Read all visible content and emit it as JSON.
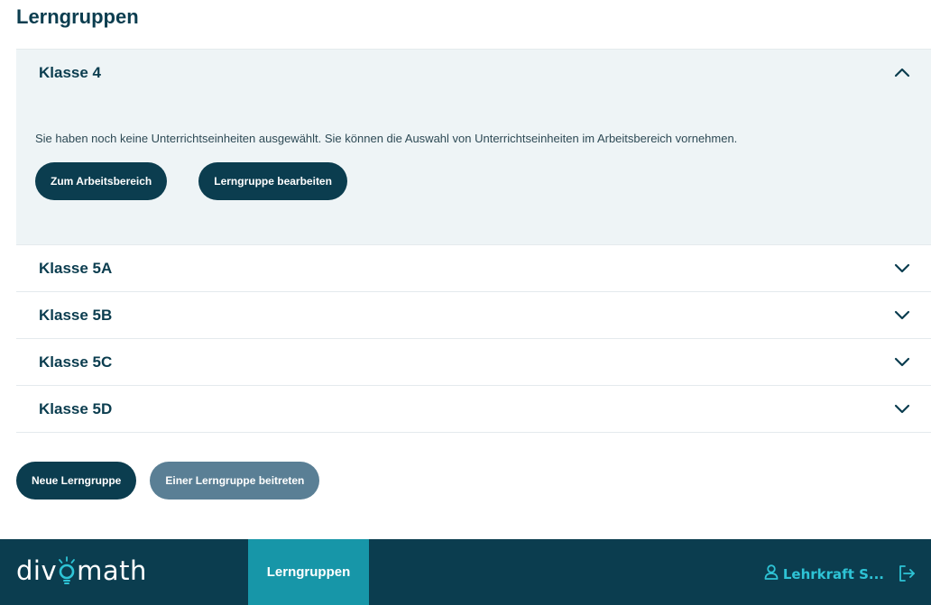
{
  "page": {
    "title": "Lerngruppen"
  },
  "groups": [
    {
      "name": "Klasse 4",
      "expanded": true,
      "message": "Sie haben noch keine Unterrichtseinheiten ausgewählt. Sie können die Auswahl von Unterrichtseinheiten im Arbeitsbereich vornehmen.",
      "buttons": [
        "Zum Arbeitsbereich",
        "Lerngruppe bearbeiten"
      ]
    },
    {
      "name": "Klasse 5A",
      "expanded": false
    },
    {
      "name": "Klasse 5B",
      "expanded": false
    },
    {
      "name": "Klasse 5C",
      "expanded": false
    },
    {
      "name": "Klasse 5D",
      "expanded": false
    }
  ],
  "actions": {
    "new_group": "Neue Lerngruppe",
    "join_group": "Einer Lerngruppe beitreten"
  },
  "footer": {
    "logo_text_left": "div",
    "logo_text_right": "math",
    "nav_active": "Lerngruppen",
    "user_label": "Lehrkraft S...",
    "icons": {
      "user": "user-icon",
      "logout": "logout-icon",
      "logo": "lightbulb-icon"
    }
  },
  "colors": {
    "primary": "#0b3d4f",
    "accent": "#1796a8",
    "highlight": "#2ec4d6",
    "secondary_button": "#5a7f95",
    "panel_bg": "#eef4f6"
  }
}
